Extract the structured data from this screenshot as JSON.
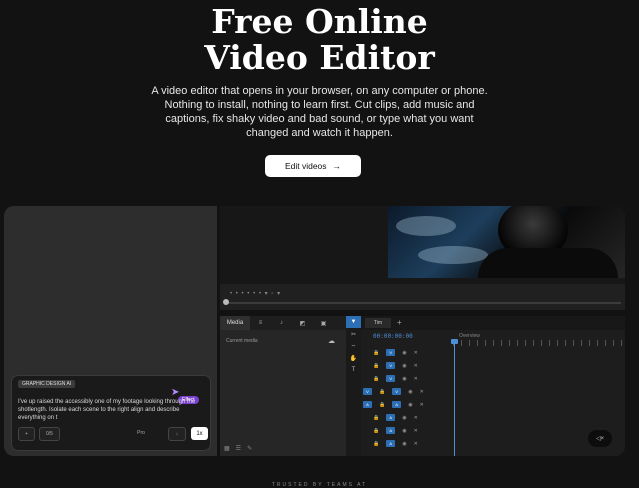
{
  "hero": {
    "title_line1": "Free Online",
    "title_line2": "Video Editor",
    "subtitle_line1": "A video editor that opens in your browser, on any computer or phone.",
    "subtitle_line2": "Nothing to install, nothing to learn first. Cut clips, add music and",
    "subtitle_line3": "captions, fix shaky video and bad sound, or type what you want",
    "subtitle_line4": "changed and watch it happen.",
    "cta_label": "Edit videos",
    "cta_arrow": "→"
  },
  "editor": {
    "media": {
      "tabs": [
        "Media",
        "",
        "",
        "",
        ""
      ],
      "row": "Current media"
    },
    "timeline": {
      "tab_label": "Tim",
      "timecode": "00:00:00:00",
      "ruler_label": "Overview"
    },
    "caption": {
      "badge": "GRAPHIC DESIGN AI",
      "text": "I've up raised the accessibly one of my footage looking through the shotlength. Isolate each scene to the right align and describe everything on t",
      "pill": "Effect",
      "ctrl_1": "+",
      "ctrl_2": "0/5",
      "ctrl_3": "Pro",
      "ctrl_4": "↓",
      "send": "1x"
    },
    "float_label": "◁×"
  },
  "footer": {
    "trusted": "TRUSTED BY TEAMS AT"
  },
  "colors": {
    "accent": "#2d6fb4",
    "ai_pill": "#7a3fd1",
    "background": "#131212"
  }
}
